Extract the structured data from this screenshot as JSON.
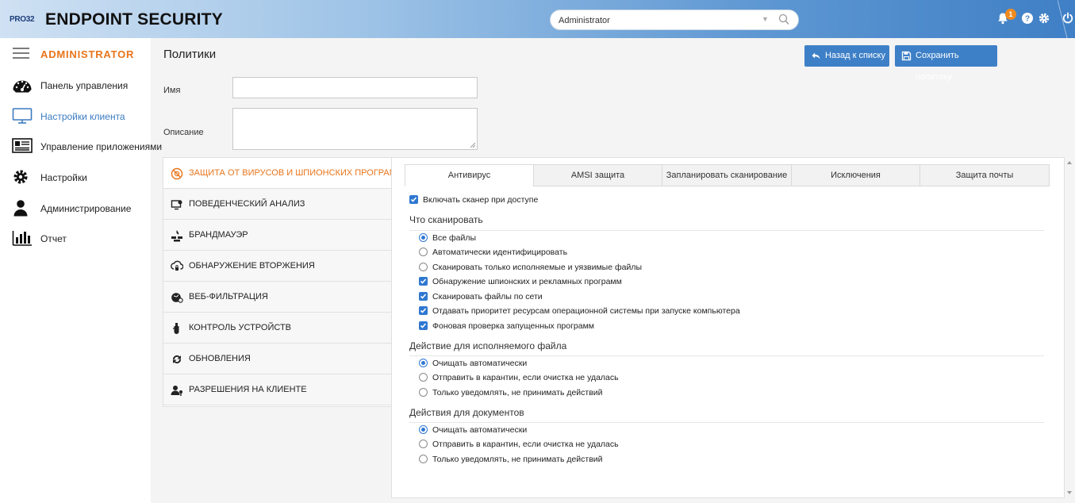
{
  "header": {
    "brand_prefix": "PRO32",
    "brand_title": "ENDPOINT SECURITY",
    "search_value": "Administrator",
    "notification_count": "1"
  },
  "sidebar": {
    "admin_label": "ADMINISTRATOR",
    "items": [
      {
        "label": "Панель управления",
        "icon": "dashboard-icon"
      },
      {
        "label": "Настройки клиента",
        "icon": "monitor-icon",
        "active": true
      },
      {
        "label": "Управление приложениями",
        "icon": "apps-icon"
      },
      {
        "label": "Настройки",
        "icon": "gear-icon"
      },
      {
        "label": "Администрирование",
        "icon": "user-icon"
      },
      {
        "label": "Отчет",
        "icon": "report-icon"
      }
    ]
  },
  "main": {
    "title": "Политики",
    "back_button": "Назад к списку",
    "save_button": "Сохранить политику",
    "name_label": "Имя",
    "name_value": "",
    "description_label": "Описание",
    "description_value": ""
  },
  "sections": [
    {
      "label": "ЗАЩИТА ОТ ВИРУСОВ И ШПИОНСКИХ ПРОГРАММ",
      "icon": "virus-shield-icon",
      "active": true
    },
    {
      "label": "ПОВЕДЕНЧЕСКИЙ АНАЛИЗ",
      "icon": "behavior-icon"
    },
    {
      "label": "БРАНДМАУЭР",
      "icon": "firewall-icon"
    },
    {
      "label": "ОБНАРУЖЕНИЕ ВТОРЖЕНИЯ",
      "icon": "intrusion-icon"
    },
    {
      "label": "ВЕБ-ФИЛЬТРАЦИЯ",
      "icon": "web-filter-icon"
    },
    {
      "label": "КОНТРОЛЬ УСТРОЙСТВ",
      "icon": "device-icon"
    },
    {
      "label": "ОБНОВЛЕНИЯ",
      "icon": "update-icon"
    },
    {
      "label": "РАЗРЕШЕНИЯ НА КЛИЕНТЕ",
      "icon": "permissions-icon"
    }
  ],
  "tabs": [
    "Антивирус",
    "AMSI защита",
    "Запланировать сканирование",
    "Исключения",
    "Защита почты"
  ],
  "antivirus": {
    "enable_scanner": {
      "label": "Включать сканер при доступе",
      "checked": true
    },
    "what_to_scan": {
      "title": "Что сканировать",
      "radios": [
        {
          "label": "Все файлы",
          "selected": true
        },
        {
          "label": "Автоматически идентифицировать",
          "selected": false
        },
        {
          "label": "Сканировать только исполняемые и уязвимые файлы",
          "selected": false
        }
      ],
      "checks": [
        {
          "label": "Обнаружение шпионских и рекламных программ",
          "checked": true
        },
        {
          "label": "Сканировать файлы по сети",
          "checked": true
        },
        {
          "label": "Отдавать приоритет ресурсам операционной системы при запуске компьютера",
          "checked": true
        },
        {
          "label": "Фоновая проверка запущенных программ",
          "checked": true
        }
      ]
    },
    "exec_action": {
      "title": "Действие для исполняемого файла",
      "radios": [
        {
          "label": "Очищать автоматически",
          "selected": true
        },
        {
          "label": "Отправить в карантин, если очистка не удалась",
          "selected": false
        },
        {
          "label": "Только уведомлять, не принимать действий",
          "selected": false
        }
      ]
    },
    "doc_action": {
      "title": "Действия для документов",
      "radios": [
        {
          "label": "Очищать автоматически",
          "selected": true
        },
        {
          "label": "Отправить в карантин, если очистка не удалась",
          "selected": false
        },
        {
          "label": "Только уведомлять, не принимать действий",
          "selected": false
        }
      ]
    }
  },
  "colors": {
    "accent_orange": "#e8741b",
    "button_blue": "#3e80c7",
    "check_blue": "#2f78d1"
  }
}
